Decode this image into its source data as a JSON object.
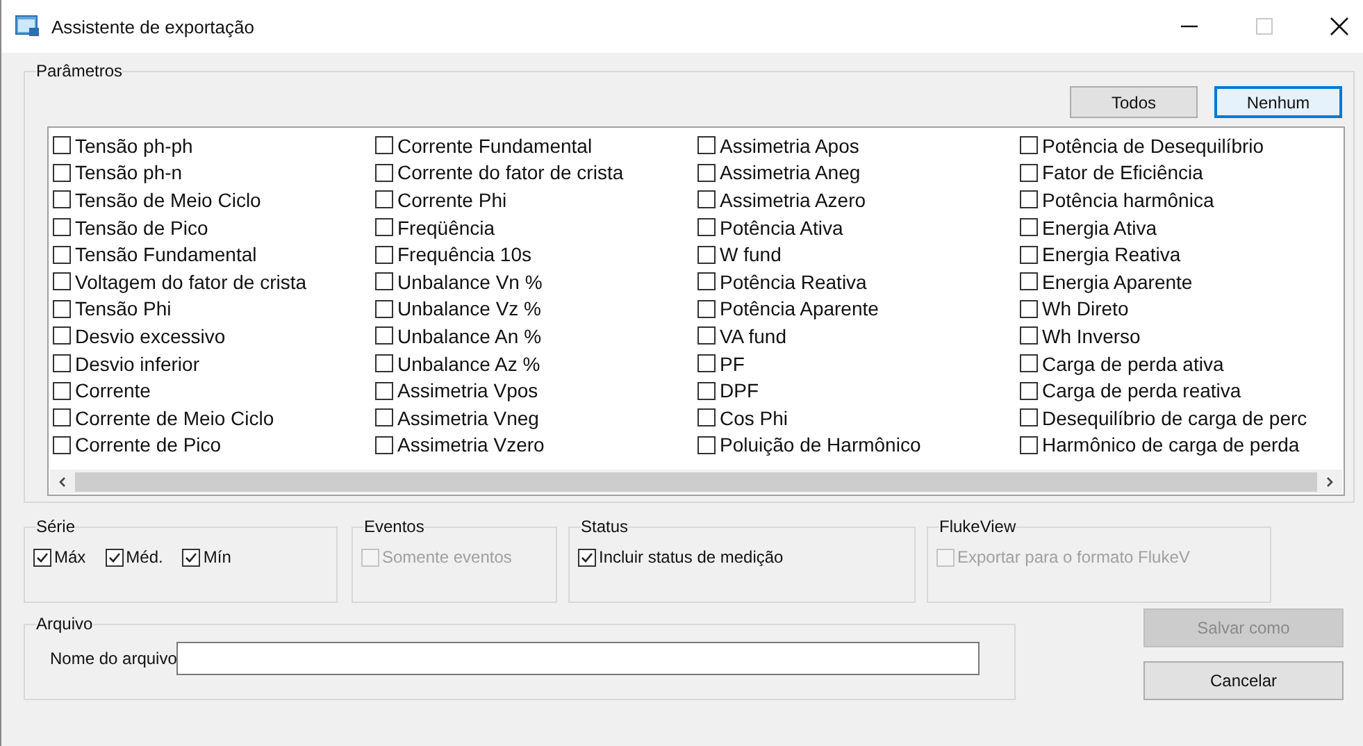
{
  "window": {
    "title": "Assistente de exportação"
  },
  "parameters": {
    "title": "Parâmetros",
    "buttons": [
      {
        "label": "Todos",
        "focused": false
      },
      {
        "label": "Nenhum",
        "focused": true
      }
    ],
    "columns": [
      {
        "items": [
          {
            "label": "Tensão ph-ph",
            "checked": false
          },
          {
            "label": "Tensão ph-n",
            "checked": false
          },
          {
            "label": "Tensão de Meio Ciclo",
            "checked": false
          },
          {
            "label": "Tensão de Pico",
            "checked": false
          },
          {
            "label": "Tensão Fundamental",
            "checked": false
          },
          {
            "label": "Voltagem do fator de crista",
            "checked": false
          },
          {
            "label": "Tensão Phi",
            "checked": false
          },
          {
            "label": "Desvio excessivo",
            "checked": false
          },
          {
            "label": "Desvio inferior",
            "checked": false
          },
          {
            "label": "Corrente",
            "checked": false
          },
          {
            "label": "Corrente de Meio Ciclo",
            "checked": false
          },
          {
            "label": "Corrente de Pico",
            "checked": false
          }
        ]
      },
      {
        "items": [
          {
            "label": "Corrente Fundamental",
            "checked": false
          },
          {
            "label": "Corrente do fator de crista",
            "checked": false
          },
          {
            "label": "Corrente Phi",
            "checked": false
          },
          {
            "label": "Freqüência",
            "checked": false
          },
          {
            "label": "Frequência 10s",
            "checked": false
          },
          {
            "label": "Unbalance Vn %",
            "checked": false
          },
          {
            "label": "Unbalance Vz %",
            "checked": false
          },
          {
            "label": "Unbalance An %",
            "checked": false
          },
          {
            "label": "Unbalance Az %",
            "checked": false
          },
          {
            "label": "Assimetria Vpos",
            "checked": false
          },
          {
            "label": "Assimetria Vneg",
            "checked": false
          },
          {
            "label": "Assimetria Vzero",
            "checked": false
          }
        ]
      },
      {
        "items": [
          {
            "label": "Assimetria Apos",
            "checked": false
          },
          {
            "label": "Assimetria Aneg",
            "checked": false
          },
          {
            "label": "Assimetria Azero",
            "checked": false
          },
          {
            "label": "Potência Ativa",
            "checked": false
          },
          {
            "label": "W fund",
            "checked": false
          },
          {
            "label": "Potência Reativa",
            "checked": false
          },
          {
            "label": "Potência Aparente",
            "checked": false
          },
          {
            "label": "VA fund",
            "checked": false
          },
          {
            "label": "PF",
            "checked": false
          },
          {
            "label": "DPF",
            "checked": false
          },
          {
            "label": "Cos Phi",
            "checked": false
          },
          {
            "label": "Poluição de Harmônico",
            "checked": false
          }
        ]
      },
      {
        "items": [
          {
            "label": "Potência de Desequilíbrio",
            "checked": false
          },
          {
            "label": "Fator de Eficiência",
            "checked": false
          },
          {
            "label": "Potência harmônica",
            "checked": false
          },
          {
            "label": "Energia Ativa",
            "checked": false
          },
          {
            "label": "Energia Reativa",
            "checked": false
          },
          {
            "label": "Energia Aparente",
            "checked": false
          },
          {
            "label": "Wh Direto",
            "checked": false
          },
          {
            "label": "Wh Inverso",
            "checked": false
          },
          {
            "label": "Carga de perda ativa",
            "checked": false
          },
          {
            "label": "Carga de perda reativa",
            "checked": false
          },
          {
            "label": "Desequilíbrio de carga de perc",
            "checked": false
          },
          {
            "label": "Harmônico de carga de perda",
            "checked": false
          }
        ]
      }
    ]
  },
  "groups": [
    {
      "title": "Série",
      "options": [
        {
          "label": "Máx",
          "checked": true,
          "disabled": false
        },
        {
          "label": "Méd.",
          "checked": true,
          "disabled": false
        },
        {
          "label": "Mín",
          "checked": true,
          "disabled": false
        }
      ]
    },
    {
      "title": "Eventos",
      "options": [
        {
          "label": "Somente eventos",
          "checked": false,
          "disabled": true
        }
      ]
    },
    {
      "title": "Status",
      "options": [
        {
          "label": "Incluir status de medição",
          "checked": true,
          "disabled": false
        }
      ]
    },
    {
      "title": "FlukeView",
      "options": [
        {
          "label": "Exportar para o formato FlukeV",
          "checked": false,
          "disabled": true
        }
      ]
    }
  ],
  "file": {
    "title": "Arquivo",
    "label": "Nome do arquivo"
  },
  "actions": [
    {
      "label": "Salvar como",
      "disabled": true
    },
    {
      "label": "Cancelar",
      "disabled": false
    }
  ]
}
